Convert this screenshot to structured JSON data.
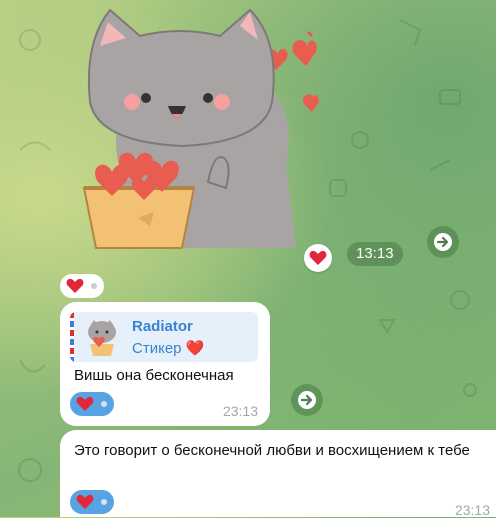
{
  "chat": {
    "sticker_message": {
      "time": "13:13",
      "sticker": "sad-cat-holding-pot-of-hearts-sticker",
      "reaction": "red-heart-emoji"
    },
    "message_1": {
      "reply": {
        "name": "Radiator",
        "subtitle": "Стикер ❤️"
      },
      "text": "Вишь она бесконечная",
      "reaction": "red-heart-emoji",
      "time": "23:13"
    },
    "message_2": {
      "text": "Это говорит о бесконечной любви и восхищением к тебе",
      "reaction": "red-heart-emoji",
      "time": "23:13"
    }
  },
  "colors": {
    "bubble": "#ffffff",
    "accent_blue": "#3a83d1",
    "reaction_chip": "#58a4e3",
    "time_pill": "rgba(60,110,60,.45)"
  }
}
